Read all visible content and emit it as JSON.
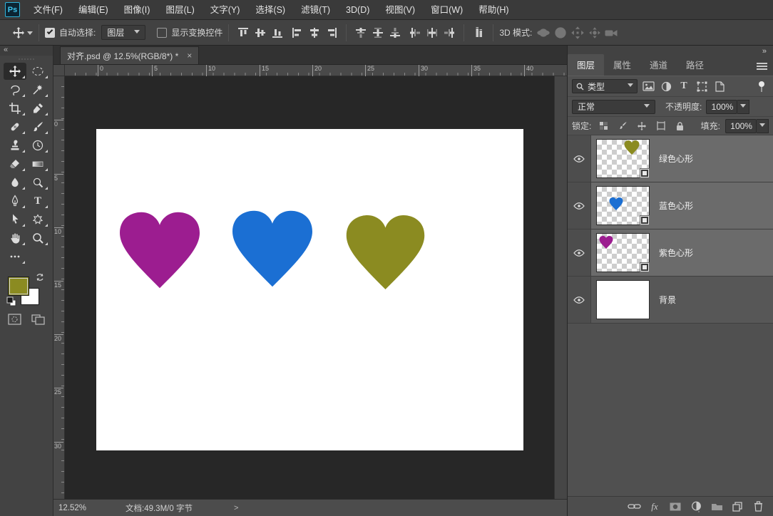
{
  "app": {
    "logo": "Ps"
  },
  "menu": {
    "items": [
      "文件(F)",
      "编辑(E)",
      "图像(I)",
      "图层(L)",
      "文字(Y)",
      "选择(S)",
      "滤镜(T)",
      "3D(D)",
      "视图(V)",
      "窗口(W)",
      "帮助(H)"
    ]
  },
  "options_bar": {
    "auto_select_label": "自动选择:",
    "auto_select_checked": true,
    "auto_select_value": "图层",
    "show_transform_label": "显示变换控件",
    "show_transform_checked": false,
    "mode_3d_label": "3D 模式:",
    "align_icons": [
      "align-top-edges",
      "align-vertical-centers",
      "align-bottom-edges",
      "align-left-edges",
      "align-horizontal-centers",
      "align-right-edges",
      "distribute-top-edges",
      "distribute-vertical-centers",
      "distribute-bottom-edges",
      "distribute-left-edges",
      "distribute-horizontal-centers",
      "distribute-right-edges",
      "auto-align-layers"
    ]
  },
  "document": {
    "tab_title": "对齐.psd @ 12.5%(RGB/8*) *",
    "close": "×",
    "rulers": {
      "horizontal": [
        "0",
        "5",
        "10",
        "15",
        "20",
        "25",
        "30",
        "35",
        "40"
      ],
      "vertical": [
        "0",
        "5",
        "10",
        "15",
        "20",
        "25",
        "30"
      ]
    }
  },
  "canvas": {
    "background": "#ffffff",
    "hearts": [
      {
        "name": "紫色心形",
        "color": "#9c1d90"
      },
      {
        "name": "蓝色心形",
        "color": "#1b6fd3"
      },
      {
        "name": "绿色心形",
        "color": "#8b8b21"
      }
    ]
  },
  "toolbar": {
    "foreground_color": "#8b8b21",
    "background_color": "#ffffff",
    "collapse": "«"
  },
  "dock": {
    "collapse": "»",
    "tabs": [
      "图层",
      "属性",
      "通道",
      "路径"
    ],
    "filter_label": "类型",
    "blend_mode": "正常",
    "opacity_label": "不透明度:",
    "opacity_value": "100%",
    "lock_label": "锁定:",
    "fill_label": "填充:",
    "fill_value": "100%",
    "layers": [
      {
        "name": "绿色心形",
        "color": "#8b8b21",
        "visible": true,
        "selected": true
      },
      {
        "name": "蓝色心形",
        "color": "#1b6fd3",
        "visible": true,
        "selected": true
      },
      {
        "name": "紫色心形",
        "color": "#9c1d90",
        "visible": true,
        "selected": true
      },
      {
        "name": "背景",
        "color": "#ffffff",
        "visible": true,
        "selected": false
      }
    ]
  },
  "status_bar": {
    "zoom": "12.52%",
    "doc_info": "文档:49.3M/0 字节",
    "chevron": ">"
  },
  "icons": {
    "type_tool": "T",
    "text_filter": "T",
    "fx": "fx"
  }
}
